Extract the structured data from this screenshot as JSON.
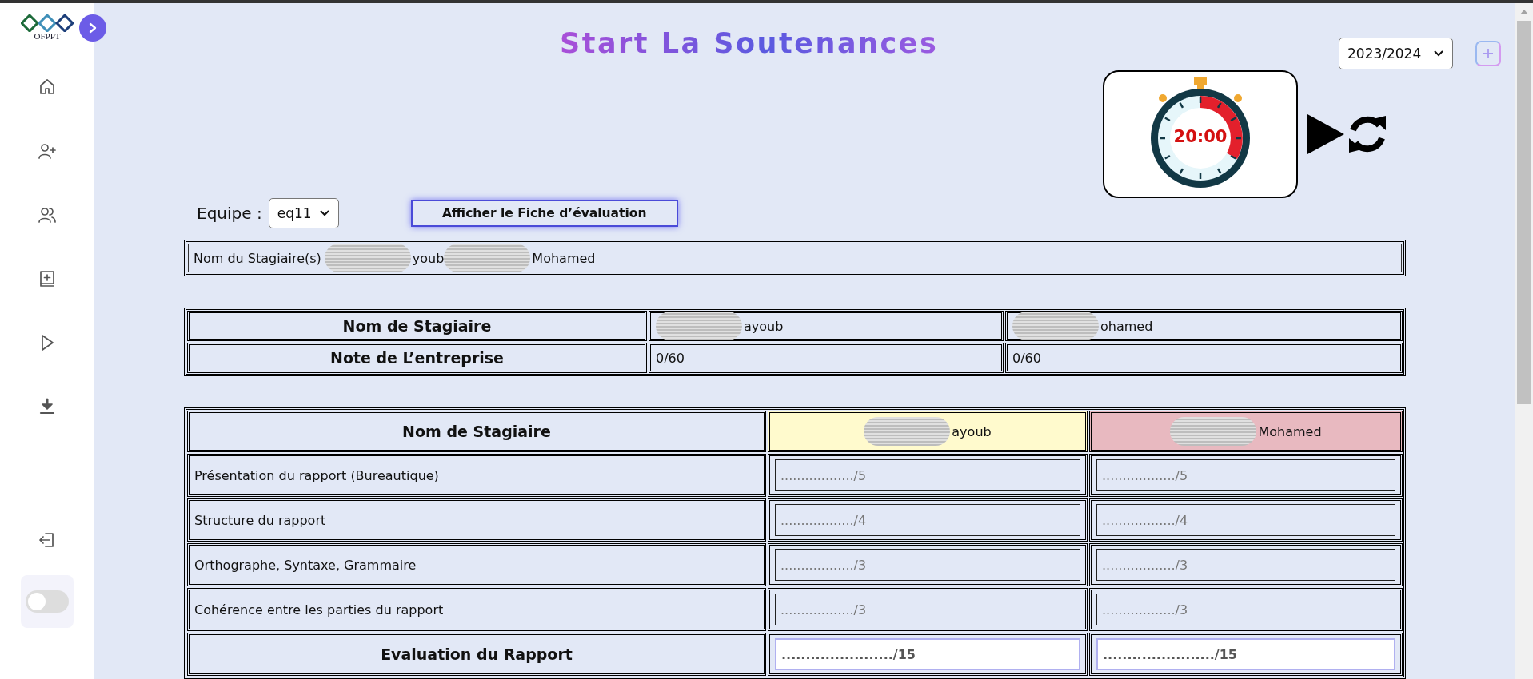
{
  "sidebar": {
    "logo_text": "OFPPT",
    "toggle": {
      "on": false
    }
  },
  "header": {
    "title": "Start La Soutenances",
    "year_select": {
      "value": "2023/2024"
    }
  },
  "timer": {
    "time": "20:00"
  },
  "team": {
    "label": "Equipe :",
    "value": "eq11",
    "button": "Afficher le Fiche d’évaluation"
  },
  "names_field": {
    "label": "Nom du Stagiaire(s)",
    "names": [
      {
        "text": "youb",
        "redacted": true
      },
      {
        "text": "Mohamed",
        "redacted": true
      }
    ]
  },
  "company_table": {
    "rows": [
      {
        "header": "Nom de Stagiaire",
        "cells": [
          {
            "text": "ayoub",
            "redacted": true
          },
          {
            "text": "ohamed",
            "redacted": true
          }
        ]
      },
      {
        "header": "Note de L’entreprise",
        "cells": [
          {
            "text": "0/60",
            "redacted": false
          },
          {
            "text": "0/60",
            "redacted": false
          }
        ]
      }
    ]
  },
  "evaluation_table": {
    "header": "Nom de Stagiaire",
    "students": [
      {
        "name": "ayoub",
        "redacted": true,
        "color": "#fffacd"
      },
      {
        "name": "Mohamed",
        "redacted": true,
        "color": "#e8b9c0"
      }
    ],
    "criteria": [
      {
        "kind": "criterion",
        "label": "Présentation du rapport (Bureautique)",
        "placeholders": [
          "................../5",
          "................../5"
        ]
      },
      {
        "kind": "criterion",
        "label": "Structure du rapport",
        "placeholders": [
          "................../4",
          "................../4"
        ]
      },
      {
        "kind": "criterion",
        "label": "Orthographe, Syntaxe, Grammaire",
        "placeholders": [
          "................../3",
          "................../3"
        ]
      },
      {
        "kind": "criterion",
        "label": "Cohérence entre les parties du rapport",
        "placeholders": [
          "................../3",
          "................../3"
        ]
      },
      {
        "kind": "total",
        "label": "Evaluation du Rapport",
        "placeholders": [
          "......................./15",
          "......................./15"
        ]
      }
    ]
  }
}
